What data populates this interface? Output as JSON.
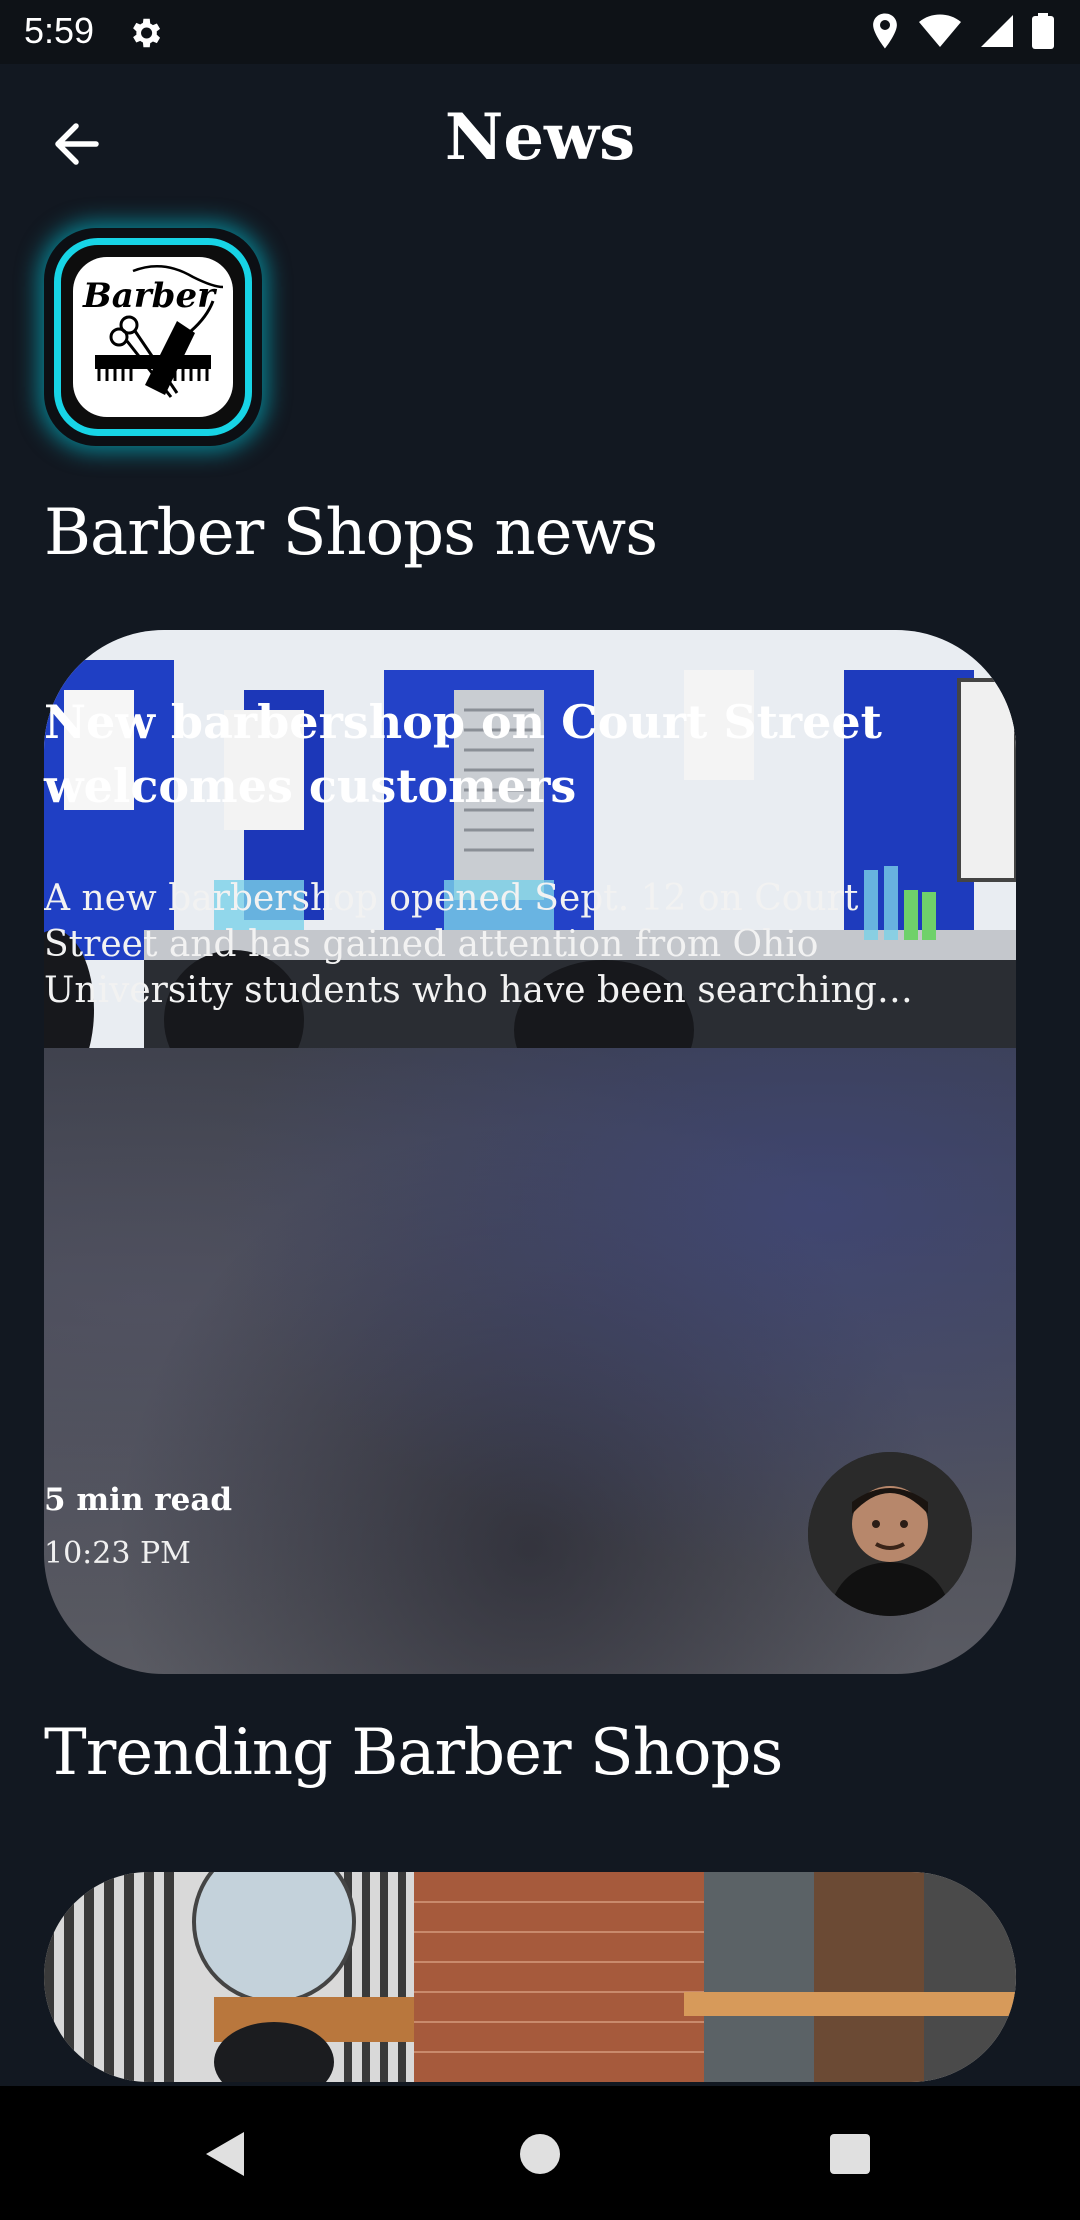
{
  "status": {
    "time": "5:59"
  },
  "header": {
    "title": "News"
  },
  "logo": {
    "text": "Barber"
  },
  "sections": {
    "news_title": "Barber Shops news",
    "trending_title": "Trending Barber Shops"
  },
  "news_card": {
    "title": "New barbershop on Court Street welcomes customers",
    "description": "A new barbershop opened Sept. 12 on Court Street and has gained attention from Ohio University students who have been searching fo...",
    "read_time": "5 min read",
    "time": "10:23 PM"
  },
  "colors": {
    "background": "#121821",
    "accent": "#17d4e6"
  }
}
